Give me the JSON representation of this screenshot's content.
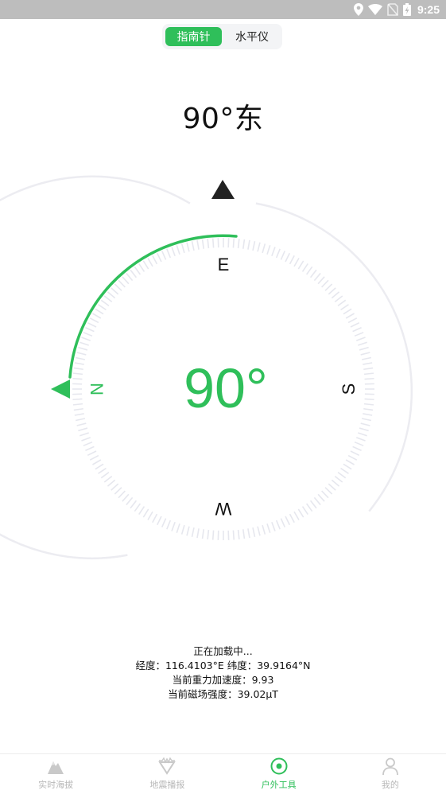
{
  "status_bar": {
    "time": "9:25",
    "icons": [
      "location-icon",
      "wifi-icon",
      "no-sim-icon",
      "battery-charging-icon"
    ]
  },
  "segmented": {
    "compass_label": "指南针",
    "level_label": "水平仪",
    "selected": "指南针"
  },
  "heading": "90°东",
  "compass": {
    "degree_label": "90°",
    "heading_degrees": 90,
    "labels": {
      "north": "N",
      "east": "E",
      "south": "S",
      "west": "W"
    },
    "accent_color": "#2fbf5a"
  },
  "info": {
    "loading": "正在加载中...",
    "coords": "经度：116.4103°E 纬度：39.9164°N",
    "gravity": "当前重力加速度：9.93",
    "magnetic": "当前磁场强度：39.02μT"
  },
  "bottom_nav": {
    "items": [
      {
        "label": "实时海拔",
        "icon": "mountain-icon"
      },
      {
        "label": "地震播报",
        "icon": "seismic-icon"
      },
      {
        "label": "户外工具",
        "icon": "compass-tool-icon"
      },
      {
        "label": "我的",
        "icon": "person-icon"
      }
    ],
    "active": "户外工具"
  }
}
